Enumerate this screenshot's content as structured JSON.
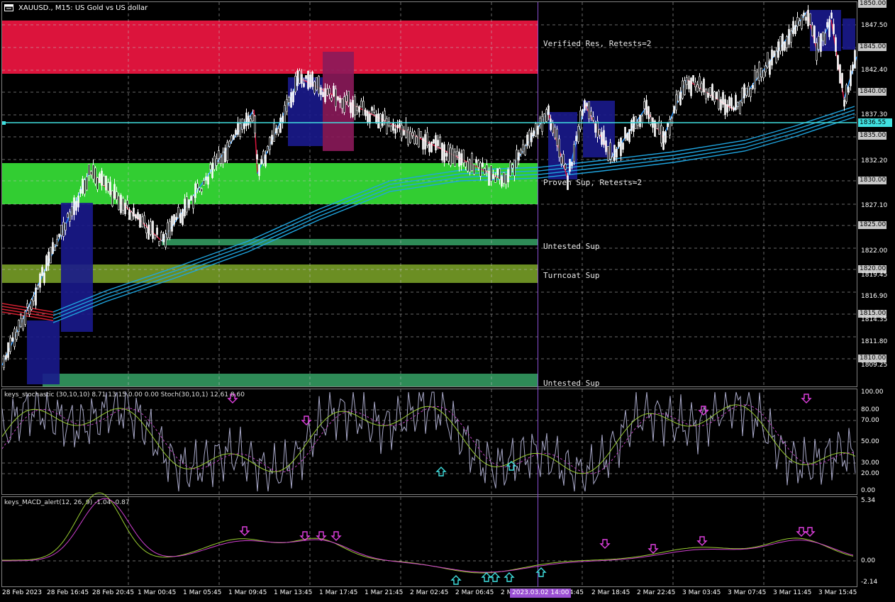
{
  "window": {
    "title": "XAUUSD., M15:  US Gold vs US dollar"
  },
  "zones": [
    {
      "label": "Verified Res, Retests=2",
      "color": "#dc143c"
    },
    {
      "label": "Proven Sup, Retests=2",
      "color": "#32cd32"
    },
    {
      "label": "Untested Sup",
      "color": "#2e8b57"
    },
    {
      "label": "Turncoat Sup",
      "color": "#6b8e23"
    },
    {
      "label": "Untested Sup",
      "color": "#2e8b57"
    }
  ],
  "price_axis": {
    "labels": [
      "1850.00",
      "1847.50",
      "1845.00",
      "1842.40",
      "1840.00",
      "1837.30",
      "1835.00",
      "1832.20",
      "1830.00",
      "1827.10",
      "1825.00",
      "1822.00",
      "1820.00",
      "1819.45",
      "1816.90",
      "1815.00",
      "1814.35",
      "1811.80",
      "1810.00",
      "1809.25"
    ],
    "boxed": [
      "1850.00",
      "1845.00",
      "1840.00",
      "1835.00",
      "1830.00",
      "1825.00",
      "1820.00",
      "1815.00",
      "1810.00"
    ],
    "current": "1836.55"
  },
  "stochastic": {
    "label": "keys_stochastic (30,10,10) 8.71 13.15 0.00 0.00 Stoch(30,10,1) 12.61 8.60",
    "levels": [
      "100.00",
      "80.00",
      "70.00",
      "50.00",
      "30.00",
      "20.00",
      "0.00"
    ]
  },
  "macd": {
    "label": "keys_MACD_alert(12, 26, 9) -1.04 -0.87",
    "levels": [
      "5.34",
      "0.00",
      "-2.14"
    ]
  },
  "time_axis": {
    "labels": [
      "28 Feb 2023",
      "28 Feb 16:45",
      "28 Feb 20:45",
      "1 Mar 00:45",
      "1 Mar 05:45",
      "1 Mar 09:45",
      "1 Mar 13:45",
      "1 Mar 17:45",
      "1 Mar 21:45",
      "2 Mar 02:45",
      "2 Mar 06:45",
      "2 M",
      "14:45",
      "2 Mar 18:45",
      "2 Mar 22:45",
      "3 Mar 03:45",
      "3 Mar 07:45",
      "3 Mar 11:45",
      "3 Mar 15:45"
    ],
    "marker": "2023.03.02 14:00"
  },
  "colors": {
    "background": "#000000",
    "bull_candle": "#ffffff",
    "zigzag_up": "#1e90ff",
    "zigzag_down": "#dc143c",
    "ma_blue": "#1fa5e0",
    "ma_red": "#d02030",
    "current_price": "#40e0e0",
    "signal_up": "#40e0e0",
    "signal_down": "#e040e0",
    "vline": "#8a4fd3"
  }
}
